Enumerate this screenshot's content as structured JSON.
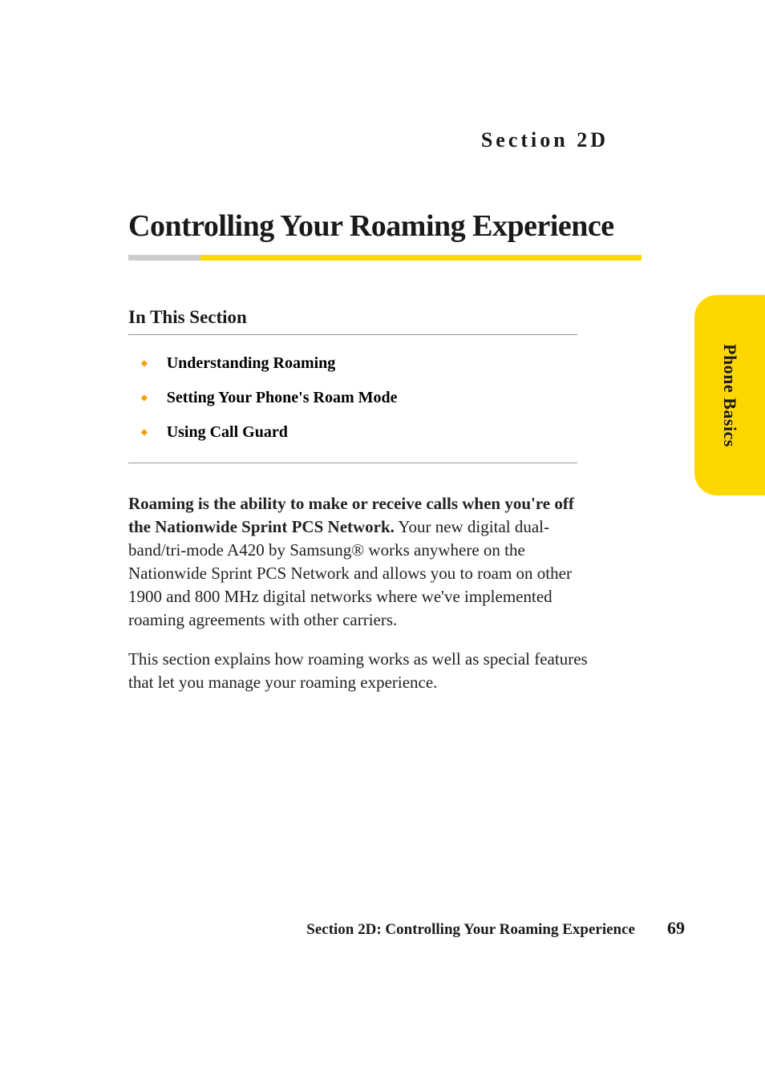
{
  "section_label": "Section 2D",
  "title": "Controlling Your Roaming Experience",
  "subheading": "In This Section",
  "toc": {
    "items": [
      {
        "label": "Understanding Roaming"
      },
      {
        "label": "Setting Your Phone's Roam Mode"
      },
      {
        "label": "Using Call Guard"
      }
    ]
  },
  "paragraphs": {
    "p1_bold": "Roaming is the ability to make or receive calls when you're off the Nationwide Sprint PCS Network.",
    "p1_rest": " Your new digital dual-band/tri-mode A420 by Samsung® works anywhere on the Nationwide Sprint PCS Network and allows you to roam on other 1900 and 800 MHz digital networks where we've implemented roaming agreements with other carriers.",
    "p2": "This section explains how roaming works as well as special features that let you manage your roaming experience."
  },
  "side_tab": "Phone Basics",
  "footer": {
    "text": "Section 2D: Controlling Your Roaming Experience",
    "page": "69"
  }
}
